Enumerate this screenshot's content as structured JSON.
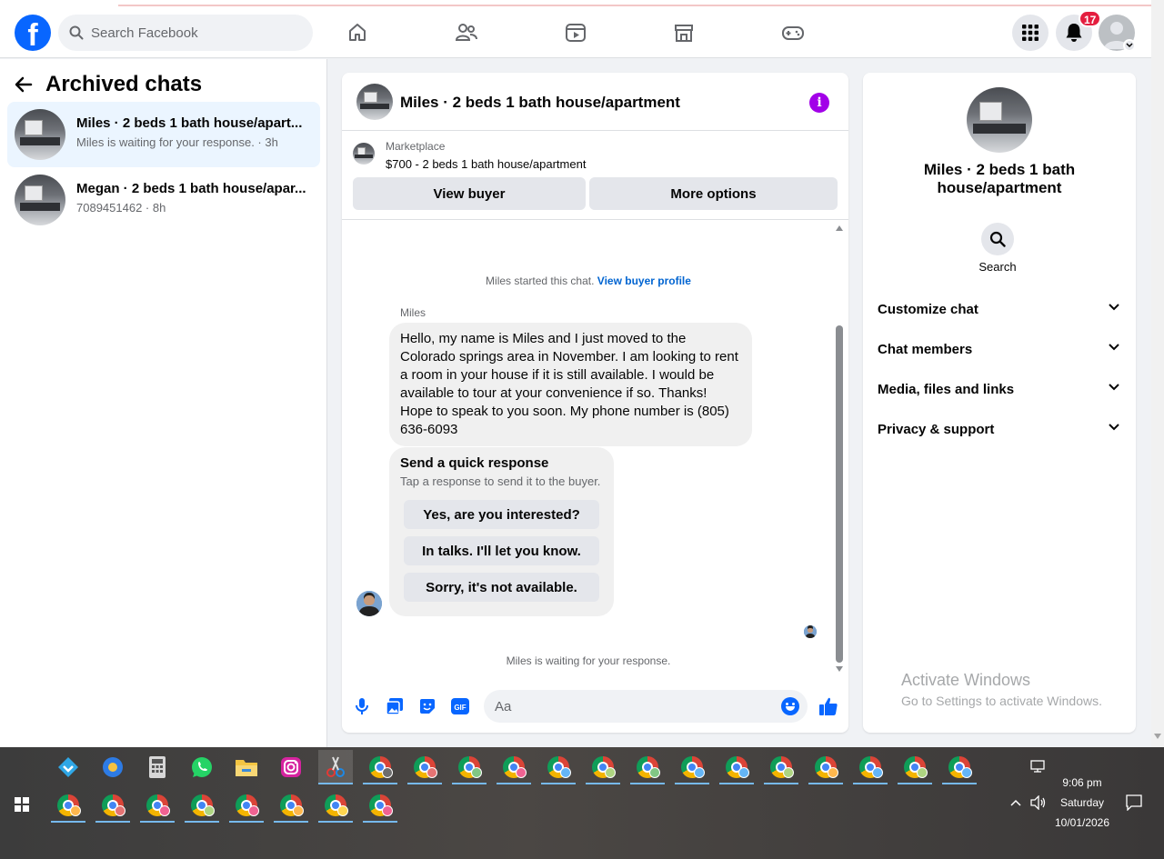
{
  "navbar": {
    "logo": "f",
    "search_placeholder": "Search Facebook",
    "notification_count": "17",
    "icons": [
      "home-icon",
      "friends-icon",
      "video-icon",
      "marketplace-icon",
      "gaming-icon"
    ]
  },
  "sidebar": {
    "title": "Archived chats",
    "chats": [
      {
        "name": "Miles · 2 beds 1 bath house/apart...",
        "sub": "Miles is waiting for your response. · 3h",
        "active": true
      },
      {
        "name": "Megan · 2 beds 1 bath house/apar...",
        "sub": "7089451462 · 8h",
        "active": false
      }
    ]
  },
  "chat": {
    "title": "Miles · 2 beds 1 bath house/apartment",
    "marketplace": {
      "kicker": "Marketplace",
      "listing": "$700 - 2 beds 1 bath house/apartment",
      "view_buyer": "View buyer",
      "more_options": "More options"
    },
    "started_text": "Miles started this chat.",
    "buyer_profile_link": "View buyer profile",
    "sender": "Miles",
    "message": "Hello, my name is Miles and I just moved to the Colorado springs area in November. I am looking to rent a room in your house if it is still available. I would be available to tour at your convenience if so. Thanks! Hope to speak to you soon. My phone number is (805) 636-6093",
    "quick": {
      "title": "Send a quick response",
      "subtitle": "Tap a response to send it to the buyer.",
      "options": [
        "Yes, are you interested?",
        "In talks. I'll let you know.",
        "Sorry, it's not available."
      ]
    },
    "waiting_text": "Miles is waiting for your response.",
    "composer_placeholder": "Aa"
  },
  "details": {
    "title": "Miles · 2 beds 1 bath house/apartment",
    "search_label": "Search",
    "sections": [
      "Customize chat",
      "Chat members",
      "Media, files and links",
      "Privacy & support"
    ]
  },
  "watermark": {
    "line1": "Activate Windows",
    "line2": "Go to Settings to activate Windows."
  },
  "taskbar": {
    "time": "9:06 pm",
    "day": "Saturday",
    "date": "10/01/2026"
  },
  "colors": {
    "brand": "#0866ff",
    "info": "#a200e8",
    "badge": "#e41e3f",
    "active_chat": "#ebf5ff"
  }
}
